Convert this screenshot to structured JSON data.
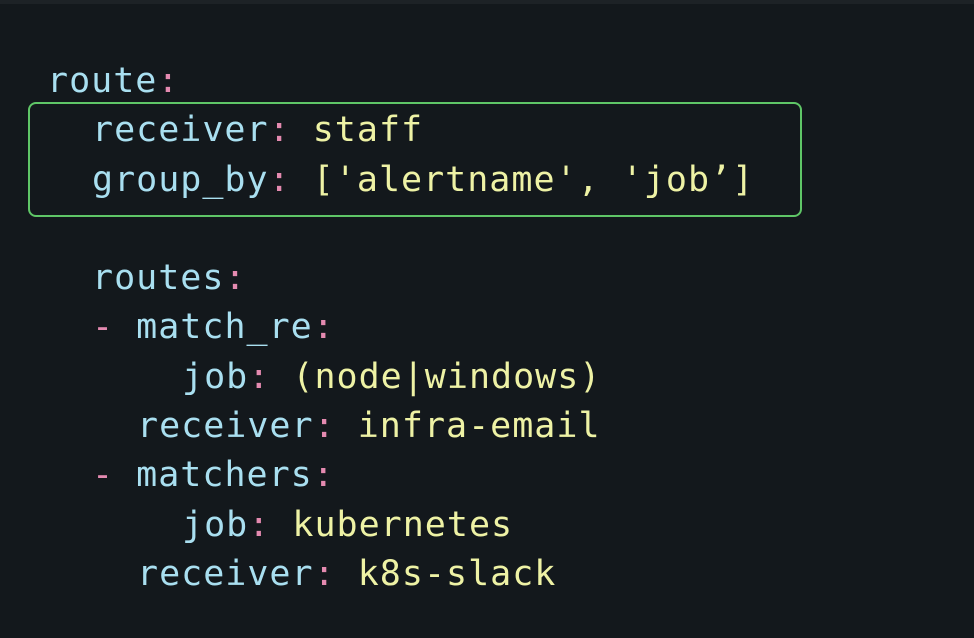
{
  "code": {
    "route_key": "route",
    "route_colon": ":",
    "receiver_key": "receiver",
    "receiver_colon": ":",
    "receiver_value": "staff",
    "group_by_key": "group_by",
    "group_by_colon": ":",
    "group_by_value": "['alertname', 'job’]",
    "routes_key": "routes",
    "routes_colon": ":",
    "dash": "-",
    "match_re_key": "match_re",
    "match_re_colon": ":",
    "job1_key": "job",
    "job1_colon": ":",
    "job1_value": "(node|windows)",
    "receiver2_key": "receiver",
    "receiver2_colon": ":",
    "receiver2_value": "infra-email",
    "matchers_key": "matchers",
    "matchers_colon": ":",
    "job2_key": "job",
    "job2_colon": ":",
    "job2_value": "kubernetes",
    "receiver3_key": "receiver",
    "receiver3_colon": ":",
    "receiver3_value": "k8s-slack"
  },
  "colors": {
    "background": "#13181c",
    "key": "#a9dff0",
    "punctuation": "#e48ab0",
    "value": "#eef2a5",
    "highlight_border": "#5fc667"
  }
}
